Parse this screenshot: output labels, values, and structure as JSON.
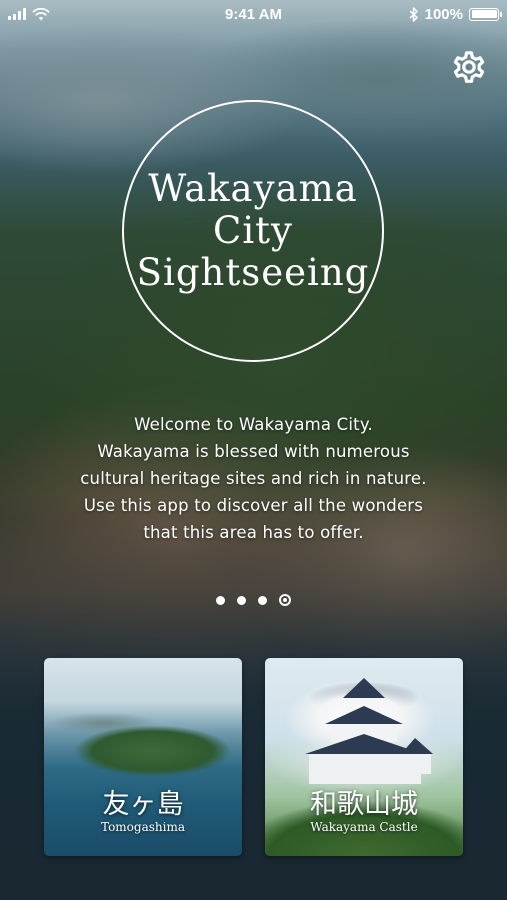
{
  "status_bar": {
    "time": "9:41 AM",
    "battery_percent": "100%",
    "battery_level": 1.0,
    "signal_bars": 4,
    "icons": [
      "signal-icon",
      "wifi-icon",
      "bluetooth-icon",
      "battery-icon"
    ]
  },
  "settings": {
    "icon": "gear-icon"
  },
  "logo": {
    "line1": "Wakayama",
    "line2": "City",
    "line3": "Sightseeing"
  },
  "intro": {
    "lines": [
      "Welcome to Wakayama City.",
      "Wakayama is blessed with numerous",
      "cultural heritage sites and rich in nature.",
      "Use this app to discover all the wonders",
      "that this area has to offer."
    ]
  },
  "pager": {
    "total": 4,
    "active_index": 3
  },
  "cards": [
    {
      "title": "友ヶ島",
      "subtitle": "Tomogashima"
    },
    {
      "title": "和歌山城",
      "subtitle": "Wakayama Castle"
    }
  ],
  "colors": {
    "text": "#ffffff",
    "background_bottom": "#1d2e38"
  }
}
